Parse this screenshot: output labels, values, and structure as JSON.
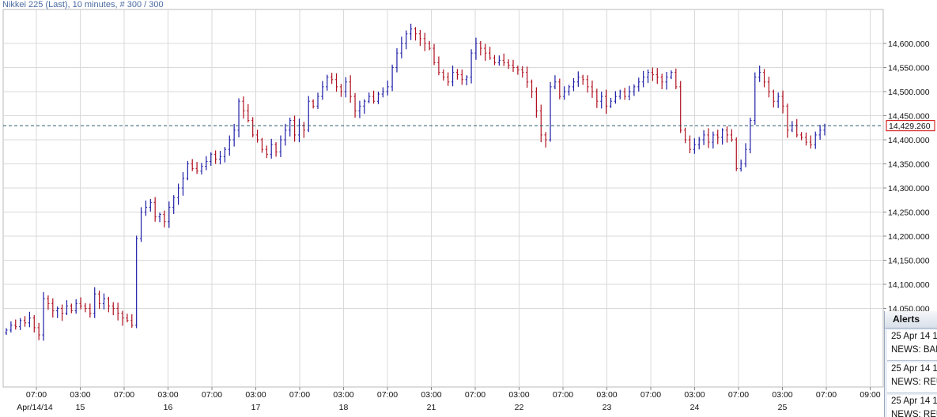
{
  "title": "Nikkei 225 (Last), 10 minutes, # 300 / 300",
  "last_price_label": "14,429.260",
  "colors": {
    "up": "#1e1ea8",
    "down": "#b01020",
    "grid": "#d9d9d9",
    "last_line": "#2a5a6a",
    "last_box": "#cc0000"
  },
  "chart_data": {
    "type": "ohlc",
    "title": "Nikkei 225 (Last), 10 minutes, # 300 / 300",
    "y_axis_position": "right",
    "ylim": [
      13980,
      14650
    ],
    "y_ticks": [
      "14,050.000",
      "14,100.000",
      "14,150.000",
      "14,200.000",
      "14,250.000",
      "14,300.000",
      "14,350.000",
      "14,400.000",
      "14,450.000",
      "14,500.000",
      "14,550.000",
      "14,600.000"
    ],
    "last_value": 14429.26,
    "x_ticks": [
      {
        "time": "07:00",
        "date": "Apr/14/14"
      },
      {
        "time": "03:00",
        "date": "15"
      },
      {
        "time": "07:00",
        "date": ""
      },
      {
        "time": "03:00",
        "date": "16"
      },
      {
        "time": "07:00",
        "date": ""
      },
      {
        "time": "03:00",
        "date": "17"
      },
      {
        "time": "07:00",
        "date": ""
      },
      {
        "time": "03:00",
        "date": "18"
      },
      {
        "time": "07:00",
        "date": ""
      },
      {
        "time": "03:00",
        "date": "21"
      },
      {
        "time": "07:00",
        "date": ""
      },
      {
        "time": "03:00",
        "date": "22"
      },
      {
        "time": "07:00",
        "date": ""
      },
      {
        "time": "03:00",
        "date": "23"
      },
      {
        "time": "07:00",
        "date": ""
      },
      {
        "time": "03:00",
        "date": "24"
      },
      {
        "time": "07:00",
        "date": ""
      },
      {
        "time": "03:00",
        "date": "25"
      },
      {
        "time": "07:00",
        "date": ""
      },
      {
        "time": "09:00",
        "date": ""
      }
    ],
    "grid": true,
    "closes": [
      14005,
      14015,
      14012,
      14025,
      14020,
      14030,
      14010,
      13995,
      14070,
      14060,
      14045,
      14050,
      14040,
      14055,
      14045,
      14060,
      14055,
      14050,
      14040,
      14080,
      14060,
      14070,
      14055,
      14050,
      14040,
      14030,
      14025,
      14015,
      14195,
      14250,
      14260,
      14270,
      14240,
      14245,
      14230,
      14260,
      14280,
      14300,
      14320,
      14350,
      14340,
      14335,
      14345,
      14355,
      14370,
      14360,
      14365,
      14380,
      14400,
      14420,
      14480,
      14460,
      14440,
      14410,
      14400,
      14380,
      14370,
      14390,
      14375,
      14400,
      14420,
      14440,
      14410,
      14430,
      14420,
      14480,
      14470,
      14490,
      14510,
      14530,
      14525,
      14510,
      14500,
      14520,
      14490,
      14460,
      14470,
      14480,
      14490,
      14480,
      14495,
      14500,
      14510,
      14550,
      14580,
      14600,
      14620,
      14630,
      14620,
      14610,
      14600,
      14590,
      14560,
      14540,
      14530,
      14520,
      14540,
      14535,
      14525,
      14530,
      14580,
      14600,
      14590,
      14580,
      14570,
      14560,
      14565,
      14560,
      14555,
      14550,
      14545,
      14540,
      14520,
      14500,
      14460,
      14410,
      14400,
      14510,
      14520,
      14490,
      14500,
      14510,
      14520,
      14530,
      14525,
      14510,
      14500,
      14480,
      14490,
      14470,
      14480,
      14490,
      14500,
      14490,
      14500,
      14510,
      14520,
      14530,
      14540,
      14535,
      14530,
      14520,
      14530,
      14540,
      14510,
      14420,
      14400,
      14380,
      14390,
      14400,
      14410,
      14395,
      14410,
      14405,
      14420,
      14410,
      14400,
      14340,
      14350,
      14380,
      14440,
      14530,
      14540,
      14520,
      14500,
      14480,
      14490,
      14470,
      14420,
      14430,
      14410,
      14405,
      14395,
      14390,
      14410,
      14420,
      14429.26
    ]
  },
  "alerts": {
    "header": "Alerts",
    "items": [
      {
        "time": "25 Apr 14 1",
        "text": "NEWS: BAN"
      },
      {
        "time": "25 Apr 14 1",
        "text": "NEWS: REU"
      },
      {
        "time": "25 Apr 14 1",
        "text": "NEWS: REU"
      }
    ]
  }
}
